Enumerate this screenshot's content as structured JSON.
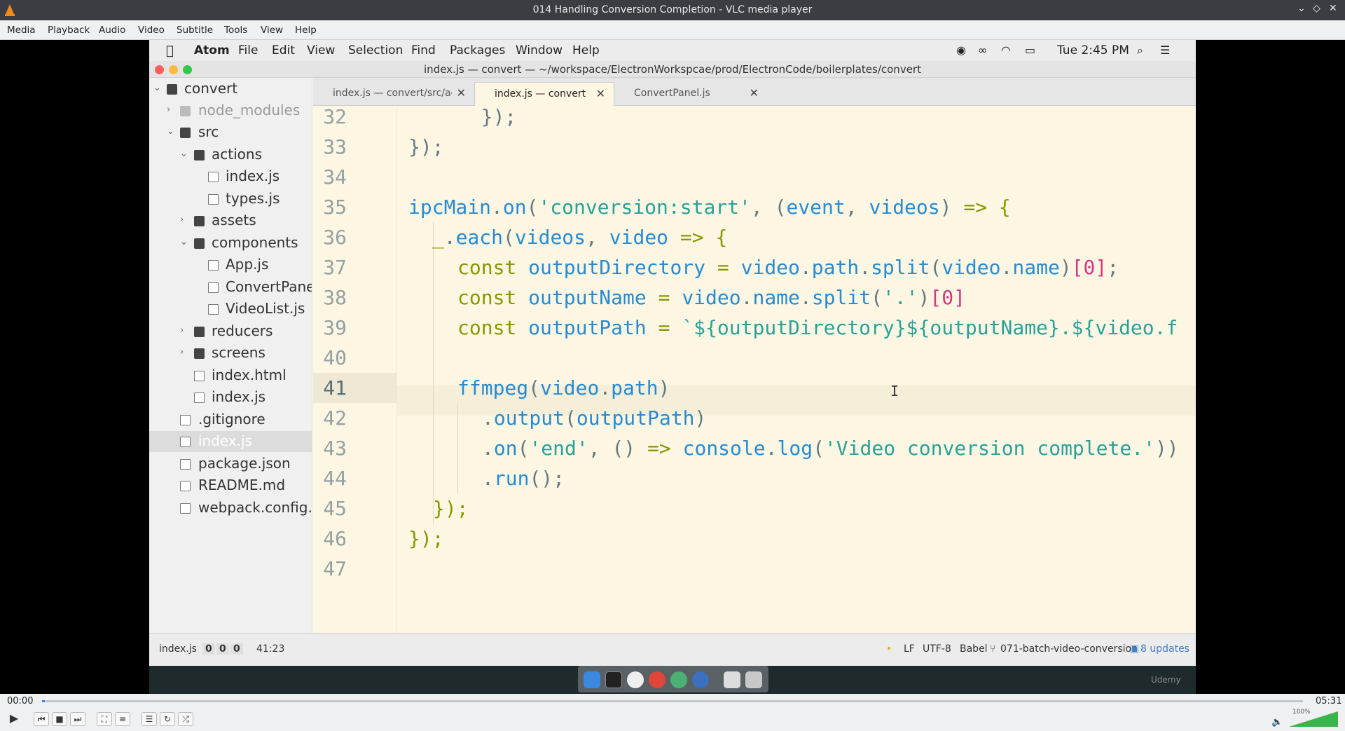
{
  "vlc": {
    "window_title": "014 Handling Conversion Completion - VLC media player",
    "menu": [
      "Media",
      "Playback",
      "Audio",
      "Video",
      "Subtitle",
      "Tools",
      "View",
      "Help"
    ],
    "time_elapsed": "00:00",
    "time_total": "05:31",
    "volume": "100%",
    "progress_fraction": 0.0
  },
  "mac_menubar": {
    "app": "Atom",
    "menus": [
      "File",
      "Edit",
      "View",
      "Selection",
      "Find",
      "Packages",
      "Window",
      "Help"
    ],
    "clock": "Tue 2:45 PM"
  },
  "atom": {
    "window_title": "index.js — convert — ~/workspace/ElectronWorkspcae/prod/ElectronCode/boilerplates/convert",
    "tabs": [
      {
        "label": "index.js — convert/src/acti...",
        "active": false
      },
      {
        "label": "index.js — convert",
        "active": true
      },
      {
        "label": "ConvertPanel.js",
        "active": false
      }
    ],
    "tree": [
      {
        "label": "convert",
        "kind": "folder",
        "expanded": true
      },
      {
        "label": "node_modules",
        "kind": "folder",
        "expanded": false
      },
      {
        "label": "src",
        "kind": "folder",
        "expanded": true
      },
      {
        "label": "actions",
        "kind": "folder",
        "expanded": true
      },
      {
        "label": "index.js",
        "kind": "file"
      },
      {
        "label": "types.js",
        "kind": "file"
      },
      {
        "label": "assets",
        "kind": "folder",
        "expanded": false
      },
      {
        "label": "components",
        "kind": "folder",
        "expanded": true
      },
      {
        "label": "App.js",
        "kind": "file"
      },
      {
        "label": "ConvertPane",
        "kind": "file"
      },
      {
        "label": "VideoList.js",
        "kind": "file"
      },
      {
        "label": "reducers",
        "kind": "folder",
        "expanded": false
      },
      {
        "label": "screens",
        "kind": "folder",
        "expanded": false
      },
      {
        "label": "index.html",
        "kind": "file"
      },
      {
        "label": "index.js",
        "kind": "file"
      },
      {
        "label": ".gitignore",
        "kind": "file"
      },
      {
        "label": "index.js",
        "kind": "file",
        "selected": true
      },
      {
        "label": "package.json",
        "kind": "file"
      },
      {
        "label": "README.md",
        "kind": "file"
      },
      {
        "label": "webpack.config.",
        "kind": "file"
      }
    ],
    "line_numbers": [
      "32",
      "33",
      "34",
      "35",
      "36",
      "37",
      "38",
      "39",
      "40",
      "41",
      "42",
      "43",
      "44",
      "45",
      "46",
      "47"
    ],
    "current_line": "41",
    "status": {
      "file": "index.js",
      "counts": [
        "0",
        "0",
        "0"
      ],
      "cursor": "41:23",
      "line_ending": "LF",
      "encoding": "UTF-8",
      "grammar": "Babel",
      "branch": "071-batch-video-conversion",
      "updates": "8 updates"
    }
  },
  "code": {
    "l32": [
      "  ",
      "});"
    ],
    "l33": [
      "",
      "});"
    ],
    "l35": [
      "ipcMain",
      ".",
      "on",
      "(",
      "'conversion:start'",
      ", (",
      "event",
      ", ",
      "videos",
      ") ",
      "=>",
      " {"
    ],
    "l36": [
      " ",
      "_",
      ".",
      "each",
      "(",
      "videos",
      ", ",
      "video",
      " ",
      "=>",
      " {"
    ],
    "l37": [
      "const",
      " ",
      "outputDirectory",
      " = ",
      "video",
      ".",
      "path",
      ".",
      "split",
      "(",
      "video",
      ".",
      "name",
      ")",
      "[0]",
      ";"
    ],
    "l38": [
      "const",
      " ",
      "outputName",
      " = ",
      "video",
      ".",
      "name",
      ".",
      "split",
      "(",
      "'.'",
      ")",
      "[0]"
    ],
    "l39": [
      "const",
      " ",
      "outputPath",
      " = ",
      "`${",
      "outputDirectory",
      "}${",
      "outputName",
      "}.${",
      "video.f"
    ],
    "l41": [
      "ffmpeg",
      "(",
      "video",
      ".",
      "path",
      ")"
    ],
    "l42": [
      ".",
      "output",
      "(",
      "outputPath",
      ")"
    ],
    "l43": [
      ".",
      "on",
      "(",
      "'end'",
      ", () ",
      "=>",
      " ",
      "console",
      ".",
      "log",
      "(",
      "'Video conversion complete.'",
      "))"
    ],
    "l44": [
      ".",
      "run",
      "();"
    ],
    "l45": [
      "});"
    ],
    "l46": [
      "});"
    ]
  },
  "branding": "Udemy"
}
